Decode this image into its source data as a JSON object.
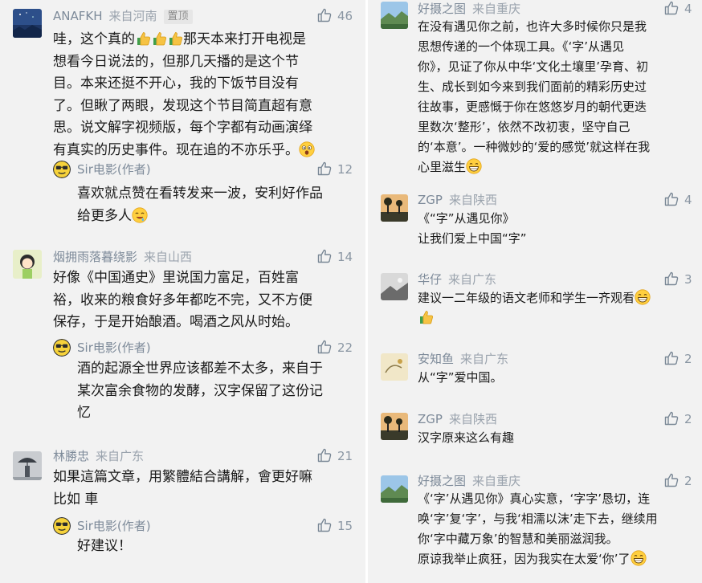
{
  "left_column": [
    {
      "author": "ANAFKH",
      "location": "来自河南",
      "pinned_label": "置顶",
      "likes": "46",
      "avatar": "night-sky-avatar",
      "text_parts": [
        "哇，这个真的",
        "那天本来打开电视是\n想看今日说法的，但那几天播的是这个节\n目。本来还挺不开心，我的下饭节目没有\n了。但瞅了两眼，发现这个节目简直超有意\n思。说文解字视频版，每个字都有动画演绎\n有真实的历史事件。现在追的不亦乐乎。"
      ],
      "emojis": [
        "thumbs-up-emoji",
        "surprised-face-emoji"
      ],
      "reply": {
        "author": "Sir电影(作者)",
        "likes": "12",
        "text": "喜欢就点赞在看转发来一波，安利好作品\n给更多人",
        "emoji": "drooling-face-emoji"
      }
    },
    {
      "author": "烟拥雨落暮绕影",
      "location": "来自山西",
      "likes": "14",
      "avatar": "cartoon-girl-avatar",
      "text": "好像《中国通史》里说国力富足，百姓富\n裕，收来的粮食好多年都吃不完，又不方便\n保存，于是开始酿酒。喝酒之风从时始。",
      "reply": {
        "author": "Sir电影(作者)",
        "likes": "22",
        "text": "酒的起源全世界应该都差不太多，来自于\n某次富余食物的发酵，汉字保留了这份记\n忆"
      }
    },
    {
      "author": "林勝忠",
      "location": "来自广东",
      "likes": "21",
      "avatar": "person-umbrella-avatar",
      "text": "如果這篇文章，用繁體結合講解，會更好嘛\n比如 車",
      "reply": {
        "author": "Sir电影(作者)",
        "likes": "15",
        "text": "好建议！"
      }
    }
  ],
  "right_column": [
    {
      "author": "好摄之图",
      "location": "来自重庆",
      "likes": "4",
      "avatar": "landscape-avatar",
      "text": "在没有遇见你之前，也许大多时候你只是我\n思想传递的一个体现工具。《‘字’从遇见\n你》，见证了你从中华‘文化土壤里’孕育、初\n生、成长到如今来到我们面前的精彩历史过\n往故事，更感慨于你在悠悠岁月的朝代更迭\n里数次‘整形’，依然不改初衷，坚守自己\n的‘本意’。一种微妙的‘爱的感觉’就这样在我\n心里滋生",
      "emoji": "grinning-face-emoji"
    },
    {
      "author": "ZGP",
      "location": "来自陕西",
      "likes": "4",
      "avatar": "sunset-tree-avatar",
      "text": "《“字”从遇见你》\n让我们爱上中国“字”"
    },
    {
      "author": "华仔",
      "location": "来自广东",
      "likes": "3",
      "avatar": "bw-photo-avatar",
      "text": "建议一二年级的语文老师和学生一齐观看",
      "emojis": [
        "grinning-face-emoji",
        "thumbs-up-emoji"
      ]
    },
    {
      "author": "安知鱼",
      "location": "来自广东",
      "likes": "2",
      "avatar": "ink-painting-avatar",
      "text": "从“字”爱中国。"
    },
    {
      "author": "ZGP",
      "location": "来自陕西",
      "likes": "2",
      "avatar": "sunset-tree-avatar",
      "text": "汉字原来这么有趣"
    },
    {
      "author": "好摄之图",
      "location": "来自重庆",
      "likes": "2",
      "avatar": "landscape-avatar",
      "text": "《‘字’从遇见你》真心实意，‘字字’恳切，连\n唤‘字’复‘字’，与我‘相濡以沫’走下去，继续用\n你‘字中藏万象’的智慧和美丽滋润我。\n原谅我举止疯狂，因为我实在太爱‘你’了",
      "emoji": "grinning-face-emoji"
    }
  ],
  "colors": {
    "name": "#7d8a99",
    "location": "#9aa3ad",
    "like": "#8a96a3",
    "text": "#1a1a1a",
    "background": "#f2f2f2"
  }
}
